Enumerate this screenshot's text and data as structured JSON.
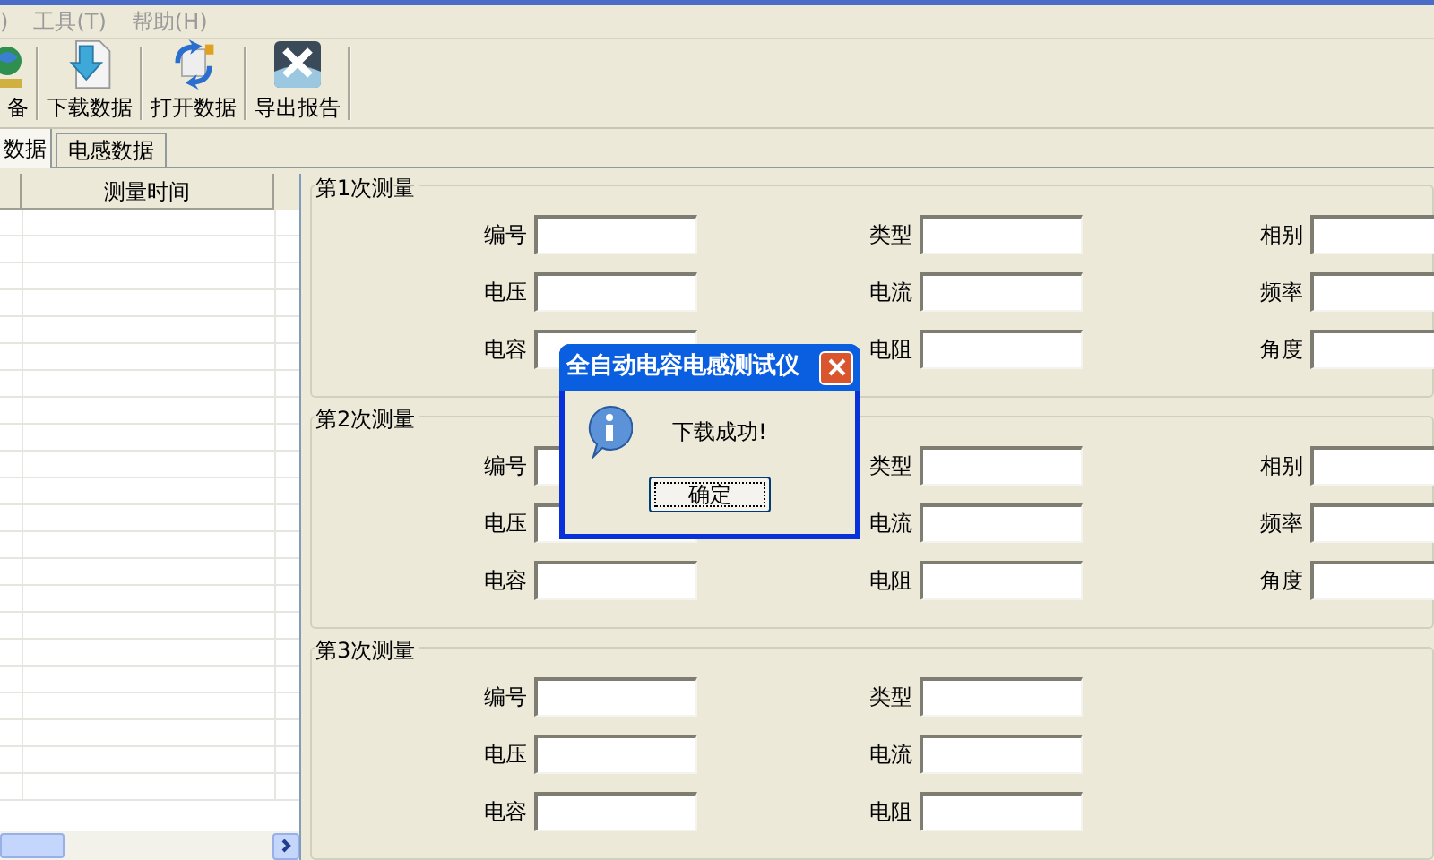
{
  "menu": [
    {
      "label": ")"
    },
    {
      "label": "工具(T)"
    },
    {
      "label": "帮助(H)"
    }
  ],
  "toolbar": [
    {
      "label": "备",
      "kind": "device"
    },
    {
      "label": "下载数据",
      "kind": "download"
    },
    {
      "label": "打开数据",
      "kind": "open"
    },
    {
      "label": "导出报告",
      "kind": "export"
    }
  ],
  "tabs": [
    {
      "label": "数据",
      "selected": true
    },
    {
      "label": "电感数据",
      "selected": false
    }
  ],
  "list": {
    "columns": [
      "",
      "测量时间"
    ]
  },
  "groups": [
    {
      "title": "第1次测量",
      "columns": [
        [
          "编号",
          "电压",
          "电容"
        ],
        [
          "类型",
          "电流",
          "电阻"
        ],
        [
          "相别",
          "频率",
          "角度"
        ]
      ]
    },
    {
      "title": "第2次测量",
      "columns": [
        [
          "编号",
          "电压",
          "电容"
        ],
        [
          "类型",
          "电流",
          "电阻"
        ],
        [
          "相别",
          "频率",
          "角度"
        ]
      ]
    },
    {
      "title": "第3次测量",
      "columns": [
        [
          "编号",
          "电压",
          "电容"
        ],
        [
          "类型",
          "电流",
          "电阻"
        ]
      ]
    }
  ],
  "dialog": {
    "title": "全自动电容电感测试仪",
    "message": "下载成功!",
    "button": "确定"
  }
}
